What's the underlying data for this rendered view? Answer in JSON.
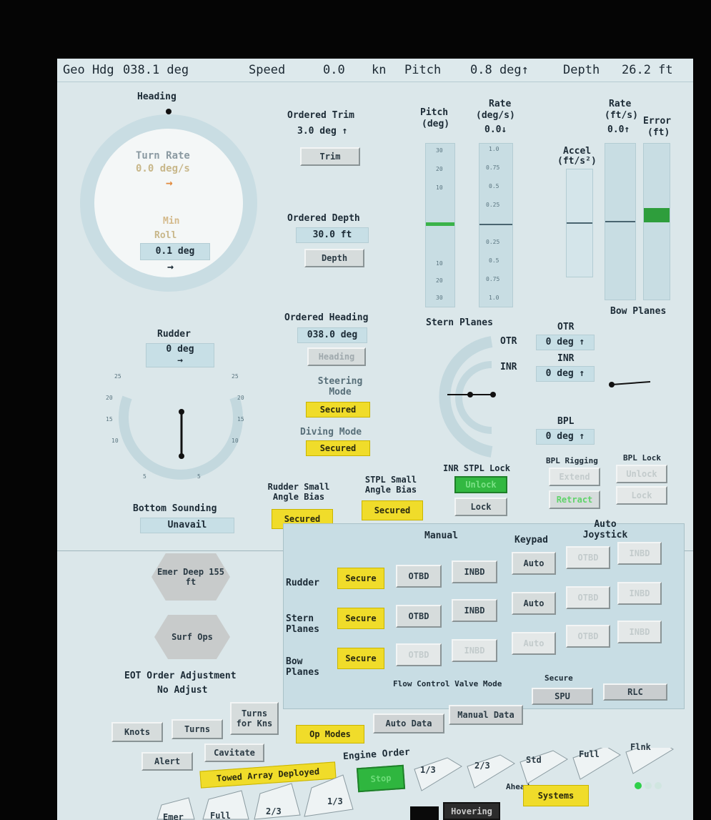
{
  "topbar": {
    "hdg_label": "Geo Hdg",
    "hdg_value": "038.1 deg",
    "speed_label": "Speed",
    "speed_value": "0.0",
    "speed_unit": "kn",
    "pitch_label": "Pitch",
    "pitch_value": "0.8 deg↑",
    "depth_label": "Depth",
    "depth_value": "26.2 ft"
  },
  "heading": {
    "title": "Heading",
    "turn_rate_label": "Turn Rate",
    "turn_rate_value": "0.0 deg/s",
    "mode": "Min",
    "roll_label": "Roll",
    "roll_value": "0.1 deg",
    "arrow": "→"
  },
  "trim": {
    "label": "Ordered Trim",
    "value": "3.0 deg ↑",
    "button": "Trim"
  },
  "depth": {
    "label": "Ordered Depth",
    "value": "30.0 ft",
    "button": "Depth"
  },
  "ordered_heading": {
    "label": "Ordered Heading",
    "value": "038.0 deg",
    "button": "Heading"
  },
  "steering_mode": {
    "label": "Steering Mode",
    "value": "Secured"
  },
  "diving_mode": {
    "label": "Diving Mode",
    "value": "Secured"
  },
  "pitch_scale": {
    "title1": "Pitch",
    "title2": "(deg)",
    "ticks": [
      "30",
      "20",
      "10",
      "",
      "10",
      "20",
      "30"
    ]
  },
  "rate_scale": {
    "title1": "Rate",
    "title2": "(deg/s)",
    "value": "0.0↓",
    "ticks": [
      "1.0",
      "0.75",
      "0.5",
      "0.25",
      "",
      "0.25",
      "0.5",
      "0.75",
      "1.0"
    ]
  },
  "accel": {
    "title1": "Accel",
    "title2": "(ft/s²)"
  },
  "rate_fts": {
    "title1": "Rate",
    "title2": "(ft/s)",
    "value": "0.0↑"
  },
  "error_ft": {
    "title1": "Error",
    "title2": "(ft)"
  },
  "bow_planes": {
    "label": "Bow Planes"
  },
  "rudder": {
    "label": "Rudder",
    "value": "0 deg",
    "arrow": "→",
    "ticks": [
      "25",
      "20",
      "15",
      "10",
      "5",
      "5",
      "10",
      "15",
      "20",
      "25"
    ]
  },
  "stern_planes": {
    "label": "Stern Planes",
    "otr_tag": "OTR",
    "inr_tag": "INR"
  },
  "otr": {
    "label": "OTR",
    "value": "0 deg ↑"
  },
  "inr": {
    "label": "INR",
    "value": "0 deg ↑"
  },
  "bpl": {
    "label": "BPL",
    "value": "0 deg ↑"
  },
  "bpl_rigging": {
    "label": "BPL Rigging",
    "extend": "Extend",
    "retract": "Retract"
  },
  "bpl_lock": {
    "label": "BPL Lock",
    "unlock": "Unlock",
    "lock": "Lock"
  },
  "inr_stpl_lock": {
    "label": "INR STPL Lock",
    "unlock": "Unlock",
    "lock": "Lock"
  },
  "rudder_bias": {
    "label": "Rudder Small Angle Bias",
    "value": "Secured"
  },
  "stpl_bias": {
    "label": "STPL Small Angle Bias",
    "value": "Secured"
  },
  "bottom_sounding": {
    "label": "Bottom Sounding",
    "value": "Unavail"
  },
  "emer_deep": {
    "label": "Emer Deep 155 ft"
  },
  "surf_ops": {
    "label": "Surf Ops"
  },
  "eot": {
    "label": "EOT Order Adjustment",
    "value": "No Adjust",
    "knots": "Knots",
    "turns": "Turns",
    "turns_for_kns": "Turns for Kns"
  },
  "alert": "Alert",
  "cavitate": "Cavitate",
  "towed_array": "Towed Array Deployed",
  "engine_order": {
    "label": "Engine Order",
    "stop": "Stop",
    "ahead_label": "Ahead",
    "ahead": [
      "1/3",
      "2/3",
      "Std",
      "Full",
      "Flnk"
    ],
    "back": [
      "1/3",
      "2/3",
      "Full",
      "Emer"
    ]
  },
  "hovering": "Hovering",
  "systems": "Systems",
  "control": {
    "manual": "Manual",
    "keypad": "Keypad",
    "auto_joystick": "Auto Joystick",
    "rows": [
      {
        "label": "Rudder",
        "secure": "Secure",
        "otbd": "OTBD",
        "inbd": "INBD",
        "auto": "Auto"
      },
      {
        "label": "Stern Planes",
        "secure": "Secure",
        "otbd": "OTBD",
        "inbd": "INBD",
        "auto": "Auto"
      },
      {
        "label": "Bow Planes",
        "secure": "Secure",
        "otbd": "OTBD",
        "inbd": "INBD",
        "auto": "Auto"
      }
    ],
    "flow_label": "Flow Control Valve Mode",
    "flow_value": "Secure",
    "spu": "SPU",
    "rlc": "RLC",
    "op_modes": "Op Modes",
    "auto_data": "Auto Data",
    "manual_data": "Manual Data"
  },
  "colors": {
    "screen": "#dbe7ea",
    "yellow": "#f0dc2a",
    "green": "#3bd04a",
    "value_box": "#c7dfe6"
  }
}
